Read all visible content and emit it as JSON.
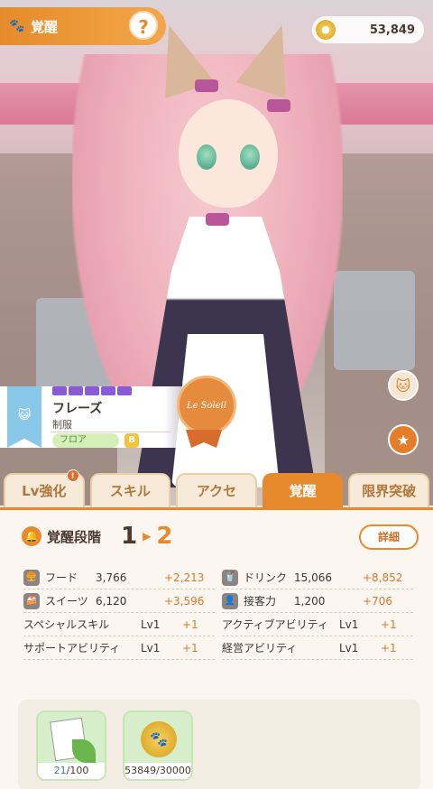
{
  "header": {
    "title": "覚醒",
    "help_label": "?",
    "coins": "53,849"
  },
  "character": {
    "name": "フレーズ",
    "outfit": "制服",
    "role": "フロア",
    "grade": "B",
    "medal_text": "Le Soleil"
  },
  "tabs": [
    {
      "label": "Lv強化",
      "badge": "!"
    },
    {
      "label": "スキル"
    },
    {
      "label": "アクセ"
    },
    {
      "label": "覚醒"
    },
    {
      "label": "限界突破"
    }
  ],
  "stage": {
    "label": "覚醒段階",
    "from": "1",
    "to": "2",
    "detail_label": "詳細"
  },
  "stats": [
    {
      "name": "フード",
      "value": "3,766",
      "gain": "+2,213"
    },
    {
      "name": "ドリンク",
      "value": "15,066",
      "gain": "+8,852"
    },
    {
      "name": "スイーツ",
      "value": "6,120",
      "gain": "+3,596"
    },
    {
      "name": "接客力",
      "value": "1,200",
      "gain": "+706"
    }
  ],
  "abilities": [
    {
      "name": "スペシャルスキル",
      "lv": "Lv1",
      "gain": "+1"
    },
    {
      "name": "アクティブアビリティ",
      "lv": "Lv1",
      "gain": "+1"
    },
    {
      "name": "サポートアビリティ",
      "lv": "Lv1",
      "gain": "+1"
    },
    {
      "name": "経営アビリティ",
      "lv": "Lv1",
      "gain": "+1"
    }
  ],
  "materials": [
    {
      "have": "21",
      "need": "/100"
    },
    {
      "have": "53849",
      "need": "/30000"
    }
  ],
  "colors": {
    "accent": "#e68a2d",
    "gain": "#e0772a"
  }
}
